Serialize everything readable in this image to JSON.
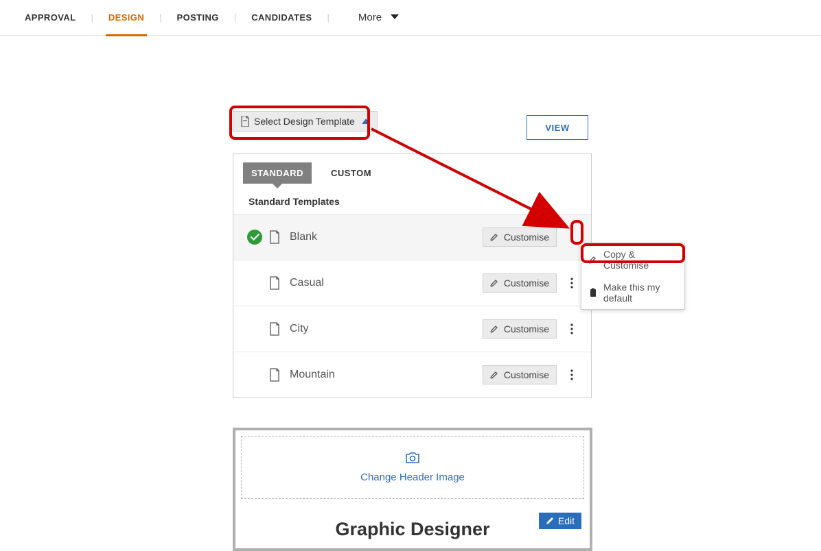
{
  "nav": {
    "tabs": [
      "APPROVAL",
      "DESIGN",
      "POSTING",
      "CANDIDATES"
    ],
    "active_index": 1,
    "more_label": "More"
  },
  "select_template_label": "Select Design Template",
  "view_button_label": "VIEW",
  "sub_tabs": {
    "standard": "STANDARD",
    "custom": "CUSTOM"
  },
  "section_title": "Standard Templates",
  "templates": [
    {
      "name": "Blank",
      "selected": true,
      "button": "Customise"
    },
    {
      "name": "Casual",
      "selected": false,
      "button": "Customise"
    },
    {
      "name": "City",
      "selected": false,
      "button": "Customise"
    },
    {
      "name": "Mountain",
      "selected": false,
      "button": "Customise"
    }
  ],
  "popup": {
    "copy_customise": "Copy & Customise",
    "make_default": "Make this my default"
  },
  "design_card": {
    "change_header": "Change Header Image",
    "job_title": "Graphic Designer",
    "edit_label": "Edit"
  }
}
